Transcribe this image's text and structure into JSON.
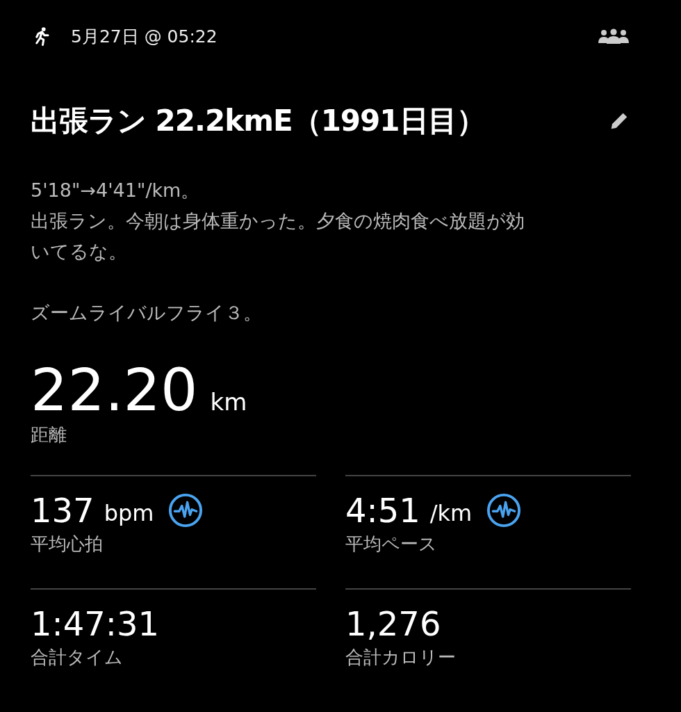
{
  "header": {
    "date": "5月27日 @ 05:22"
  },
  "title": "出張ラン 22.2kmE（1991日目）",
  "description": [
    {
      "lines": [
        "5'18\"→4'41\"/km。",
        "出張ラン。今朝は身体重かった。夕食の焼肉食べ放題が効いてるな。"
      ]
    },
    {
      "lines": [
        "ズームライバルフライ３。"
      ]
    }
  ],
  "distance": {
    "value": "22.20",
    "unit": "km",
    "label": "距離"
  },
  "stats": [
    {
      "value": "137",
      "unit": "bpm",
      "label": "平均心拍",
      "badge": true
    },
    {
      "value": "4:51",
      "unit": "/km",
      "label": "平均ペース",
      "badge": true
    },
    {
      "value": "1:47:31",
      "label": "合計タイム",
      "badge": false
    },
    {
      "value": "1,276",
      "label": "合計カロリー",
      "badge": false
    }
  ]
}
